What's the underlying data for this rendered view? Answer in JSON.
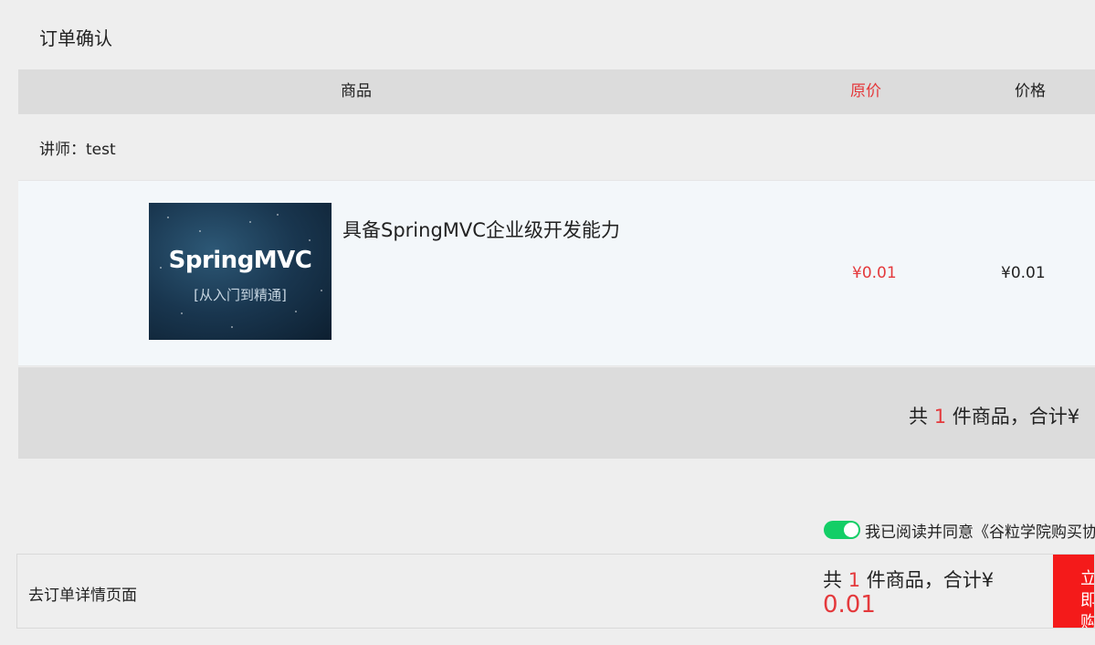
{
  "page": {
    "title": "订单确认"
  },
  "table": {
    "headers": {
      "product": "商品",
      "original_price": "原价",
      "price": "价格"
    }
  },
  "teacher": {
    "label": "讲师：test"
  },
  "item": {
    "cover": {
      "title": "SpringMVC",
      "subtitle": "[从入门到精通]"
    },
    "name": "具备SpringMVC企业级开发能力",
    "original_price": "¥0.01",
    "price": "¥0.01"
  },
  "summary": {
    "prefix": "共",
    "count": "1",
    "suffix": "件商品，合计¥"
  },
  "agreement": {
    "checked": true,
    "text": "我已阅读并同意《谷粒学院购买协议》"
  },
  "bottom": {
    "detail_link": "去订单详情页面",
    "prefix": "共",
    "count": "1",
    "suffix": "件商品，合计¥",
    "amount": "0.01",
    "buy_button": "立即购买"
  },
  "colors": {
    "accent_red": "#e4393c",
    "buy_button": "#f41a1a",
    "toggle_on": "#13ce66"
  }
}
